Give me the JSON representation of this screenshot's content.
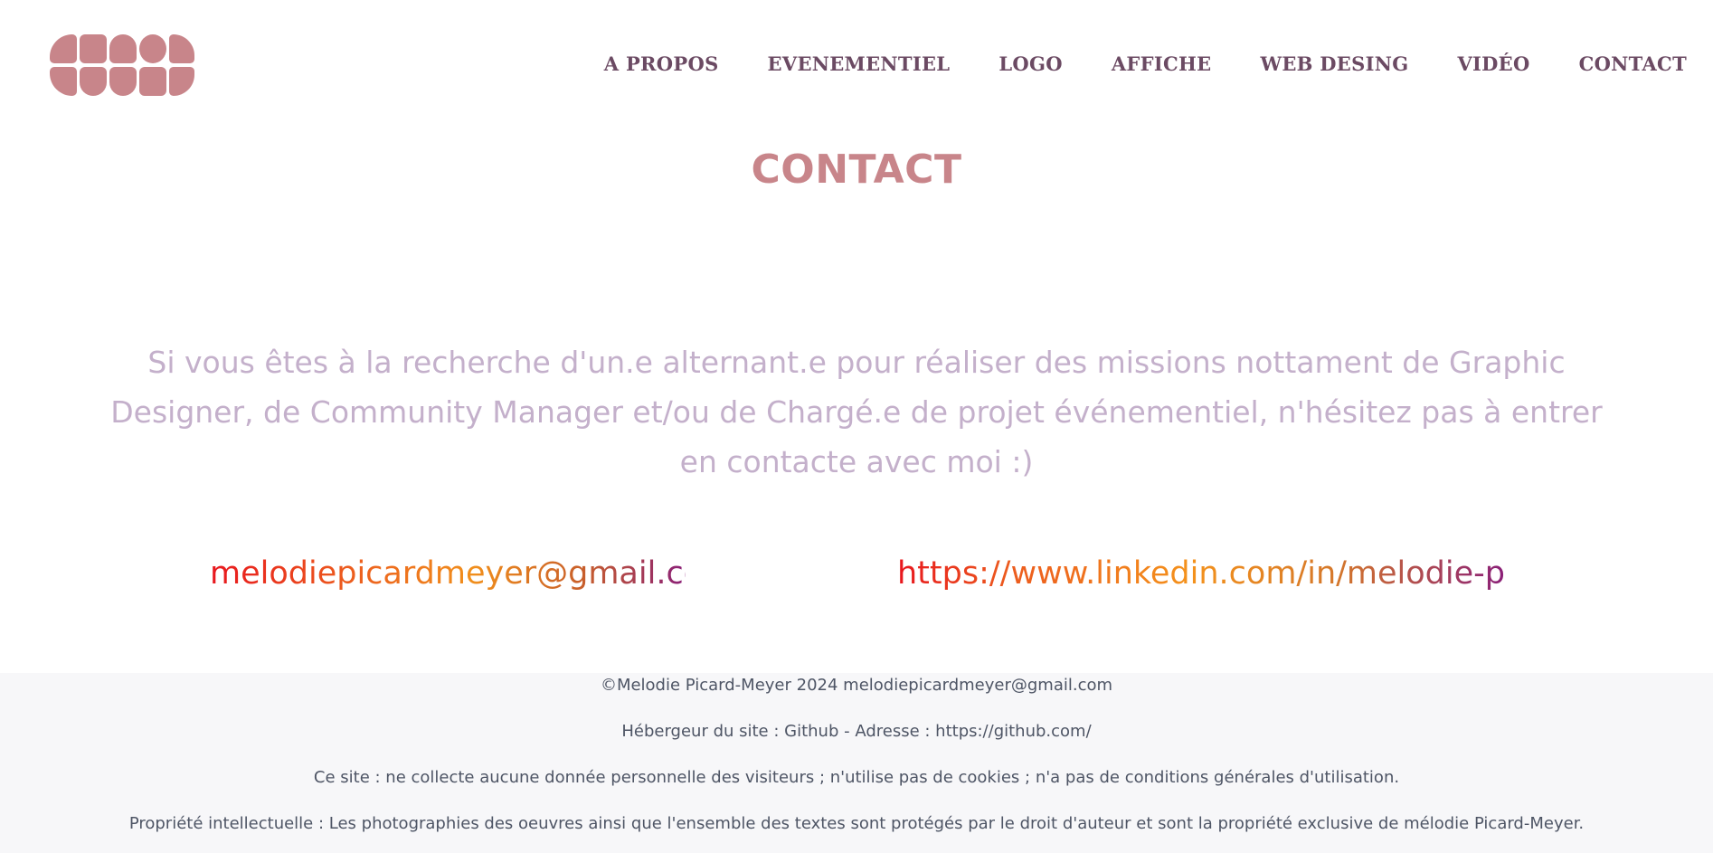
{
  "header": {
    "logo_alt": "logo",
    "nav": [
      {
        "label": "A PROPOS"
      },
      {
        "label": "EVENEMENTIEL"
      },
      {
        "label": "LOGO"
      },
      {
        "label": "AFFICHE"
      },
      {
        "label": "WEB DESING"
      },
      {
        "label": "VIDÉO"
      },
      {
        "label": "CONTACT"
      }
    ]
  },
  "main": {
    "title": "CONTACT",
    "intro": "Si vous êtes à la recherche d'un.e alternant.e pour réaliser des missions nottament de Graphic Designer, de Community Manager et/ou de Chargé.e de projet événementiel, n'hésitez pas à entrer en contacte avec moi :)",
    "email": "melodiepicardmeyer@gmail.com",
    "linkedin": "https://www.linkedin.com/in/melodie-pm/"
  },
  "footer": {
    "line1": "©Melodie Picard-Meyer 2024 melodiepicardmeyer@gmail.com",
    "line2": "Hébergeur du site : Github - Adresse : https://github.com/",
    "line3": "Ce site : ne collecte aucune donnée personnelle des visiteurs ; n'utilise pas de cookies ; n'a pas de conditions générales d'utilisation.",
    "line4": "Propriété intellectuelle : Les photographies des oeuvres ainsi que l'ensemble des textes sont protégés par le droit d'auteur et sont la propriété exclusive de mélodie Picard-Meyer."
  },
  "colors": {
    "logo": "#c8858a",
    "nav": "#6b4a63",
    "title": "#c8858a",
    "intro": "#c4b0cb",
    "footer_bg": "#f7f7f9"
  }
}
